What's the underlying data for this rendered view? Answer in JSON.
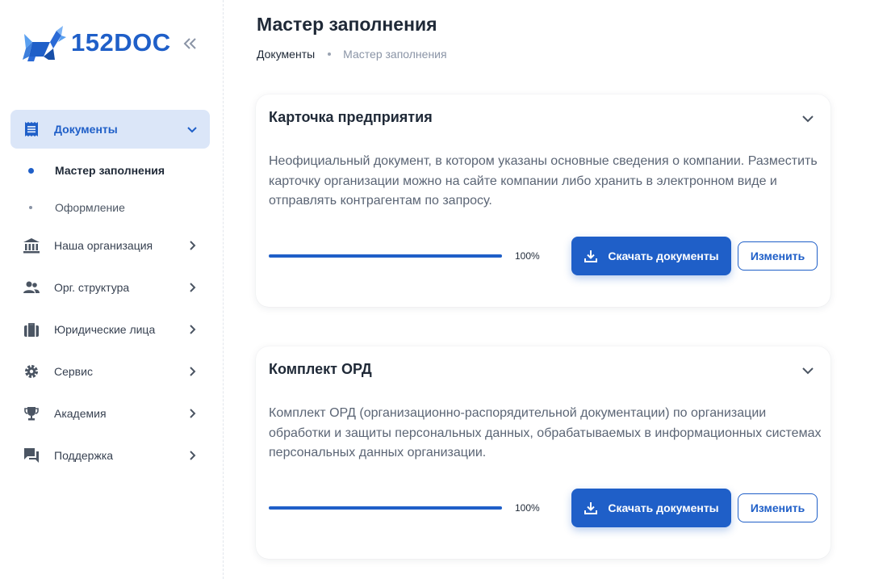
{
  "brand": {
    "name": "152DOC"
  },
  "sidebar": {
    "items": [
      {
        "label": "Документы",
        "icon": "document-list-icon"
      },
      {
        "label": "Наша организация",
        "icon": "bank-icon"
      },
      {
        "label": "Орг. структура",
        "icon": "people-icon"
      },
      {
        "label": "Юридические лица",
        "icon": "briefcase-icon"
      },
      {
        "label": "Сервис",
        "icon": "gear-icon"
      },
      {
        "label": "Академия",
        "icon": "trophy-icon"
      },
      {
        "label": "Поддержка",
        "icon": "chat-icon"
      }
    ],
    "subitems": [
      {
        "label": "Мастер заполнения"
      },
      {
        "label": "Оформление"
      }
    ]
  },
  "page": {
    "title": "Мастер заполнения",
    "breadcrumb": [
      "Документы",
      "Мастер заполнения"
    ]
  },
  "cards": [
    {
      "title": "Карточка предприятия",
      "description": "Неофициальный документ, в котором указаны основные сведения о компании. Разместить карточку организации можно на сайте компании либо хранить в электронном виде и отправлять контрагентам по запросу.",
      "progress": 100,
      "progress_label": "100%",
      "download_label": "Скачать документы",
      "edit_label": "Изменить"
    },
    {
      "title": "Комплект ОРД",
      "description": "Комплект ОРД (организационно-распорядительной документации) по организации обработки и защиты персональных данных, обрабатываемых в информационных системах персональных данных организации.",
      "progress": 100,
      "progress_label": "100%",
      "download_label": "Скачать документы",
      "edit_label": "Изменить"
    }
  ],
  "colors": {
    "accent": "#1f5fc8",
    "active_bg": "#dbe6f8",
    "muted": "#8a94a6"
  }
}
